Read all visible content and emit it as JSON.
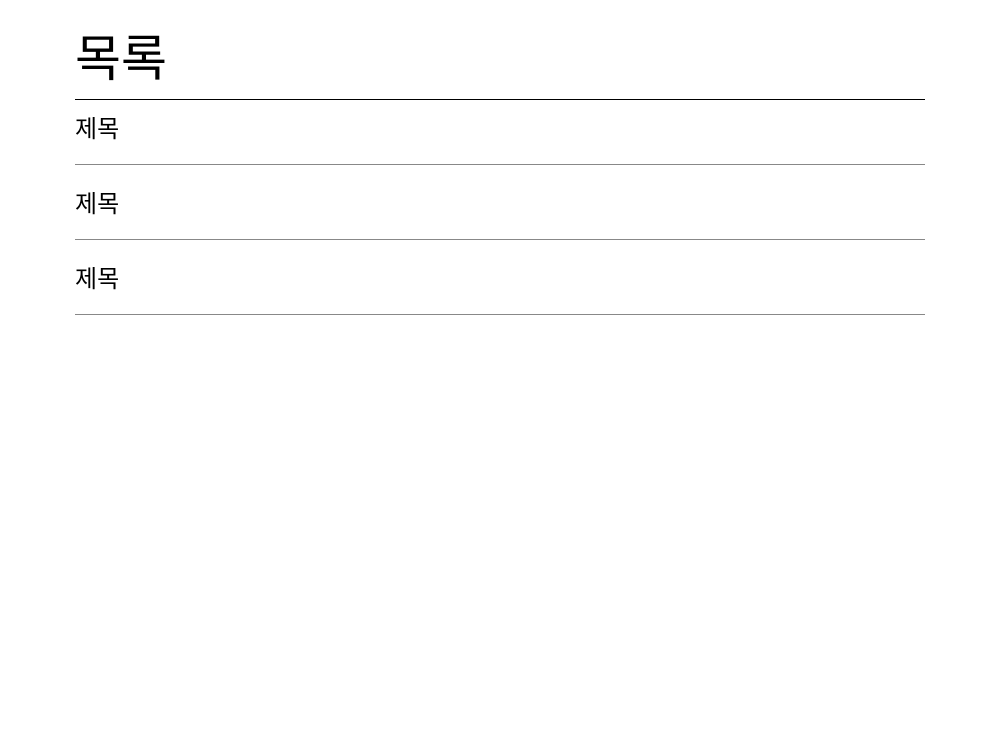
{
  "page": {
    "title": "목록",
    "items": [
      {
        "label": "제목"
      },
      {
        "label": "제목"
      },
      {
        "label": "제목"
      }
    ]
  }
}
